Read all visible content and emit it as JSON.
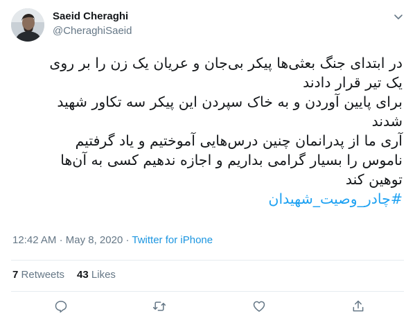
{
  "user": {
    "display_name": "Saeid Cheraghi",
    "handle": "@CheraghiSaeid"
  },
  "tweet": {
    "lines": [
      "در ابتدای جنگ بعثی‌ها پیکر بی‌جان و عریان یک زن را بر روی",
      "یک تیر قرار دادند",
      "برای پایین آوردن و به خاک سپردن این پیکر سه تکاور شهید",
      "شدند",
      "آری ما از پدرانمان چنین درس‌هایی آموختیم و یاد گرفتیم",
      "ناموس را بسیار گرامی بداریم و اجازه ندهیم کسی به آن‌ها",
      "توهین کند"
    ],
    "hashtag": "#چادر_وصیت_شهیدان"
  },
  "meta": {
    "time": "12:42 AM",
    "separator1": "·",
    "date": "May 8, 2020",
    "separator2": "·",
    "source": "Twitter for iPhone"
  },
  "stats": {
    "retweets_count": "7",
    "retweets_label": "Retweets",
    "likes_count": "43",
    "likes_label": "Likes"
  },
  "icons": {
    "avatar": "profile-photo",
    "caret": "chevron-down-icon",
    "reply": "reply-icon",
    "retweet": "retweet-icon",
    "like": "heart-icon",
    "share": "share-icon"
  },
  "colors": {
    "link": "#1da1f2",
    "secondary_text": "#657786",
    "primary_text": "#14171a",
    "divider": "#e6ecf0"
  }
}
